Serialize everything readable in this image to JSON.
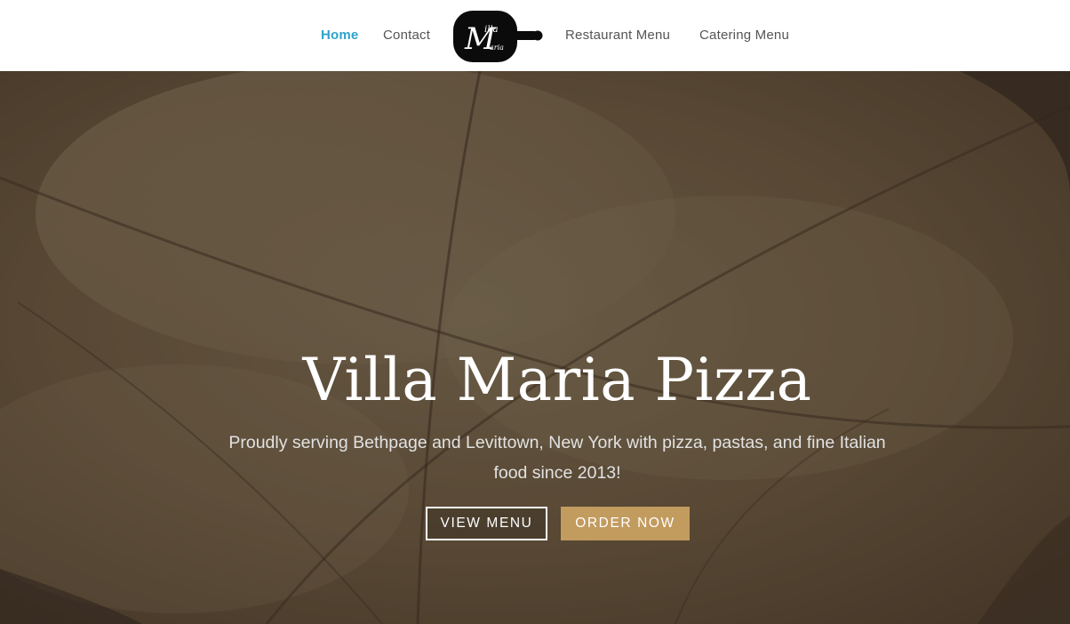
{
  "nav": {
    "left": [
      {
        "label": "Home",
        "active": true
      },
      {
        "label": "Contact",
        "active": false
      }
    ],
    "right": [
      {
        "label": "Restaurant Menu"
      },
      {
        "label": "Catering Menu"
      }
    ],
    "active_color": "#2ea3cb",
    "link_color": "#555555"
  },
  "logo": {
    "icon": "pizza-peel-logo",
    "text_big": "M",
    "text_top": "illa",
    "text_bottom": "aria"
  },
  "hero": {
    "title": "Villa Maria Pizza",
    "subtitle": "Proudly serving Bethpage and Levittown, New York with pizza, pastas, and fine Italian food since 2013!",
    "buttons": {
      "view_menu": "VIEW MENU",
      "order_now": "ORDER NOW"
    },
    "accent_color": "#c29b5e"
  }
}
